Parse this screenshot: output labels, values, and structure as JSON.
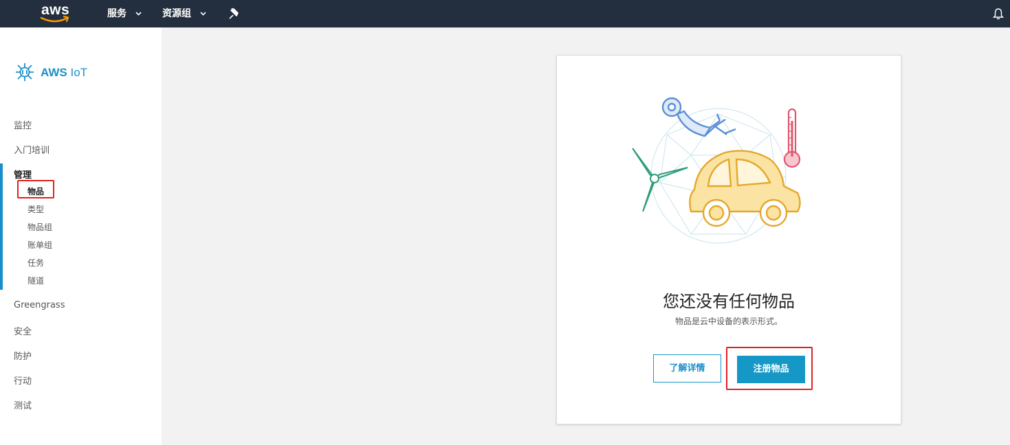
{
  "topbar": {
    "logo_text": "aws",
    "services_label": "服务",
    "resource_groups_label": "资源组"
  },
  "sidebar": {
    "brand": "AWS IoT",
    "brand_strong": "AWS",
    "brand_light": "IoT",
    "items": [
      {
        "label": "监控"
      },
      {
        "label": "入门培训"
      },
      {
        "label": "管理",
        "active": true
      },
      {
        "label": "Greengrass"
      },
      {
        "label": "安全"
      },
      {
        "label": "防护"
      },
      {
        "label": "行动"
      },
      {
        "label": "测试"
      }
    ],
    "manage_sub": [
      {
        "label": "物品",
        "active": true
      },
      {
        "label": "类型"
      },
      {
        "label": "物品组"
      },
      {
        "label": "账单组"
      },
      {
        "label": "任务"
      },
      {
        "label": "隧道"
      }
    ]
  },
  "main": {
    "empty_title": "您还没有任何物品",
    "empty_subtitle": "物品是云中设备的表示形式。",
    "learn_more_label": "了解详情",
    "register_label": "注册物品"
  },
  "colors": {
    "topbar": "#232f3e",
    "accent": "#1a8fc9",
    "button": "#1598c5",
    "highlight": "#e02020",
    "car": "#f5c242"
  },
  "icons": [
    "aws-logo",
    "chevron-down-icon",
    "pin-icon",
    "bell-icon",
    "iot-brand-icon",
    "iot-illustration"
  ]
}
